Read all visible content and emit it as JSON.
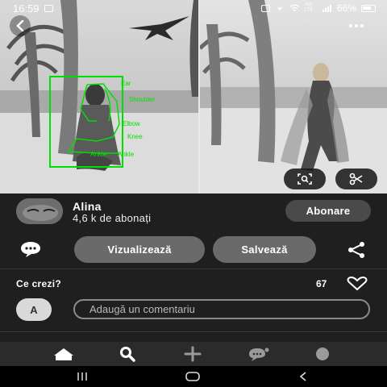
{
  "status_bar": {
    "time": "16:59",
    "network": "Vo) LTE",
    "battery": "66%",
    "icons": [
      "image-icon",
      "lock-icon",
      "hotspot-icon",
      "wifi-icon",
      "signal-icon",
      "battery-icon"
    ]
  },
  "pose_labels": [
    "Ear",
    "Shoulder",
    "Elbow",
    "Knee",
    "Ankle",
    "Ankle"
  ],
  "profile": {
    "name": "Alina",
    "followers": "4,6 k de abonați",
    "follow_label": "Abonare"
  },
  "actions": {
    "view_label": "Vizualizează",
    "save_label": "Salvează"
  },
  "comments": {
    "title": "Ce crezi?",
    "likes": "67",
    "avatar_letter": "A",
    "placeholder": "Adaugă un comentariu"
  },
  "colors": {
    "background": "#1f1f1f",
    "pose_overlay": "#00e000",
    "button_gray": "#6a6a6a"
  },
  "bottom_nav": [
    "home-icon",
    "search-icon",
    "create-icon",
    "messages-icon",
    "profile-icon"
  ],
  "system_nav": [
    "recents-icon",
    "home-button-icon",
    "back-nav-icon"
  ]
}
